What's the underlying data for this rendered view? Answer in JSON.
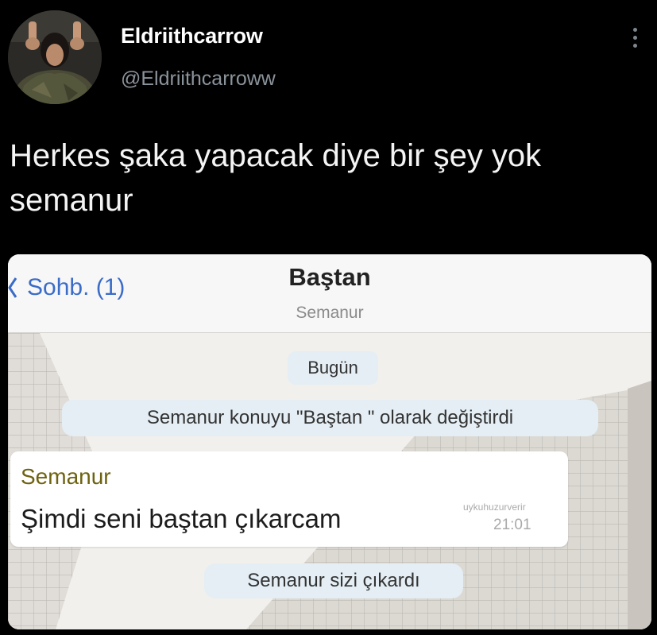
{
  "tweet": {
    "display_name": "Eldriithcarrow",
    "handle": "@Eldriithcarroww",
    "text": "Herkes şaka yapacak diye bir şey yok semanur",
    "more_icon": "more-vertical-icon"
  },
  "chat_screenshot": {
    "back_label": "Sohb. (1)",
    "back_icon": "chevron-left-icon",
    "title": "Baştan",
    "subtitle": "Semanur",
    "date_label": "Bugün",
    "system_messages": [
      "Semanur konuyu \"Baştan \" olarak değiştirdi",
      "Semanur sizi çıkardı"
    ],
    "message": {
      "sender": "Semanur",
      "text": "Şimdi seni baştan çıkarcam",
      "watermark": "uykuhuzurverir",
      "time": "21:01"
    },
    "colors": {
      "link_blue": "#3a6cc8",
      "sender_name": "#6e6210",
      "system_bubble": "#e4eef4"
    }
  }
}
